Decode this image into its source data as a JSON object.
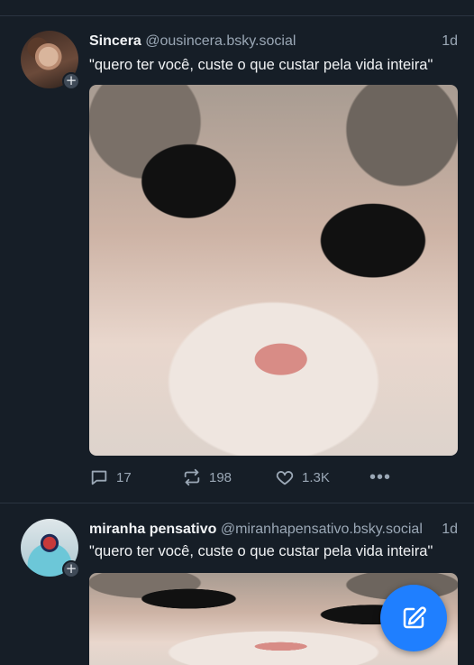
{
  "posts": [
    {
      "display_name": "Sincera",
      "handle": "@ousincera.bsky.social",
      "time": "1d",
      "text": "\"quero ter você, custe o que custar pela vida inteira\"",
      "replies": "17",
      "reposts": "198",
      "likes": "1.3K",
      "more": "•••"
    },
    {
      "display_name": "miranha pensativo",
      "handle": "@miranhapensativo.bsky.social",
      "time": "1d",
      "text": "\"quero ter você, custe o que custar pela vida inteira\""
    }
  ],
  "avatar_badge": "+",
  "colors": {
    "background": "#161e27",
    "text_primary": "#f1f3f5",
    "text_secondary": "#9aa7b5",
    "accent": "#1f7fff"
  },
  "icons": {
    "reply": "speech-bubble-icon",
    "repost": "repost-arrows-icon",
    "like": "heart-icon",
    "more": "ellipsis-icon",
    "compose": "pencil-square-icon"
  }
}
